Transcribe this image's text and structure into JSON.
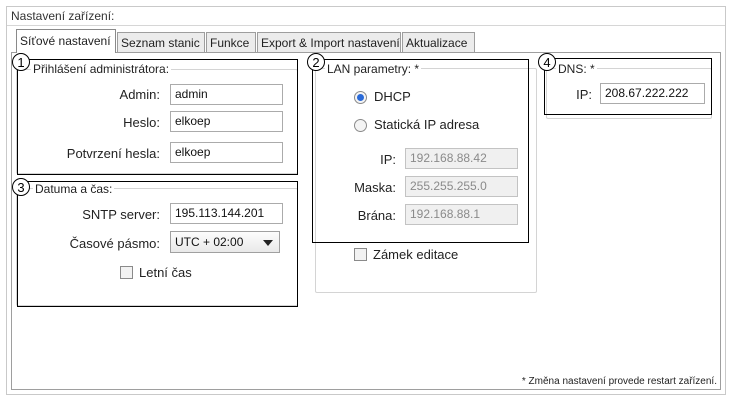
{
  "panel": {
    "title": "Nastavení zařízení:"
  },
  "tabs": [
    {
      "label": "Síťové nastavení",
      "active": true
    },
    {
      "label": "Seznam stanic",
      "active": false
    },
    {
      "label": "Funkce",
      "active": false
    },
    {
      "label": "Export & Import nastavení",
      "active": false
    },
    {
      "label": "Aktualizace",
      "active": false
    }
  ],
  "callouts": {
    "n1": "1",
    "n2": "2",
    "n3": "3",
    "n4": "4"
  },
  "admin": {
    "legend": "Přihlášení administrátora:",
    "admin_label": "Admin:",
    "admin_value": "admin",
    "password_label": "Heslo:",
    "password_value": "elkoep",
    "confirm_label": "Potvrzení hesla:",
    "confirm_value": "elkoep"
  },
  "datetime": {
    "legend": "Datuma a čas:",
    "sntp_label": "SNTP server:",
    "sntp_value": "195.113.144.201",
    "tz_label": "Časové pásmo:",
    "tz_value": "UTC + 02:00",
    "dst_label": "Letní čas"
  },
  "lan": {
    "legend": "LAN parametry: *",
    "dhcp_label": "DHCP",
    "static_label": "Statická IP adresa",
    "mode": "DHCP",
    "ip_label": "IP:",
    "ip_value": "192.168.88.42",
    "mask_label": "Maska:",
    "mask_value": "255.255.255.0",
    "gateway_label": "Brána:",
    "gateway_value": "192.168.88.1",
    "lock_label": "Zámek editace"
  },
  "dns": {
    "legend": "DNS: *",
    "ip_label": "IP:",
    "ip_value": "208.67.222.222"
  },
  "footer": {
    "note": "* Změna nastavení provede restart zařízení."
  }
}
